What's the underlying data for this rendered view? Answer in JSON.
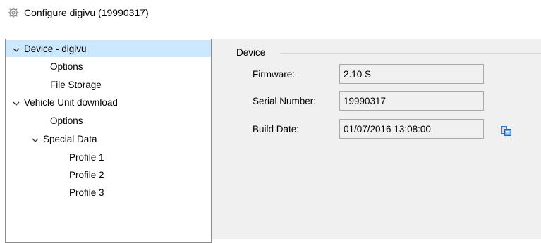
{
  "window": {
    "title": "Configure digivu (19990317)",
    "icon": "gear-icon"
  },
  "tree": {
    "items": [
      {
        "label": "Device - digivu",
        "expanded": true,
        "selected": true,
        "level": 0
      },
      {
        "label": "Options",
        "level": 1
      },
      {
        "label": "File Storage",
        "level": 1
      },
      {
        "label": "Vehicle Unit download",
        "expanded": true,
        "level": 0
      },
      {
        "label": "Options",
        "level": 1
      },
      {
        "label": "Special Data",
        "expanded": true,
        "level": 1
      },
      {
        "label": "Profile 1",
        "level": 2
      },
      {
        "label": "Profile 2",
        "level": 2
      },
      {
        "label": "Profile 3",
        "level": 2
      }
    ]
  },
  "device_group": {
    "title": "Device",
    "firmware_label": "Firmware:",
    "firmware_value": "2.10 S",
    "serial_label": "Serial Number:",
    "serial_value": "19990317",
    "build_date_label": "Build Date:",
    "build_date_value": "01/07/2016 13:08:00",
    "copy_icon": "copy-icon"
  },
  "colors": {
    "selection": "#cce8ff",
    "panel_background": "#f0f0f0",
    "tree_border": "#8c8c8c"
  }
}
